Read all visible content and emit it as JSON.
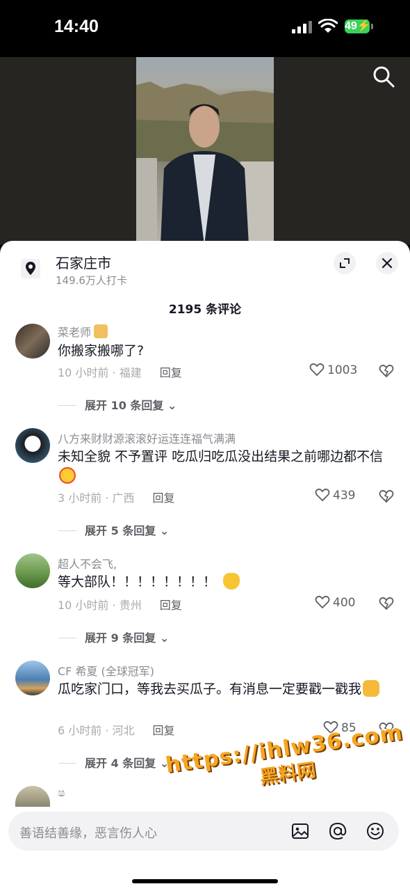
{
  "status": {
    "time": "14:40",
    "battery": "49"
  },
  "location": {
    "title": "石家庄市",
    "subtitle": "149.6万人打卡"
  },
  "comments_count": "2195 条评论",
  "comments": [
    {
      "user": "菜老师",
      "text": "你搬家搬哪了?",
      "meta": "10 小时前 · 福建",
      "reply": "回复",
      "likes": "1003",
      "expand": "展开 10 条回复"
    },
    {
      "user": "八方来财财源滚滚好运连连福气满满",
      "text": "未知全貌 不予置评 吃瓜归吃瓜没出结果之前哪边都不信",
      "meta": "3 小时前 · 广西",
      "reply": "回复",
      "likes": "439",
      "expand": "展开 5 条回复"
    },
    {
      "user": "超人不会飞,",
      "text": "等大部队！！！！！！！！",
      "meta": "10 小时前 · 贵州",
      "reply": "回复",
      "likes": "400",
      "expand": "展开 9 条回复"
    },
    {
      "user": "CF 希夏 (全球冠军)",
      "text": "瓜吃家门口，等我去买瓜子。有消息一定要戳一戳我",
      "meta": "6 小时前 · 河北",
      "reply": "回复",
      "likes": "85",
      "expand": "展开 4 条回复"
    }
  ],
  "input": {
    "placeholder": "善语结善缘，恶言伤人心"
  },
  "watermark": {
    "line1": "https://ihlw36.com",
    "line2": "黑料网"
  },
  "icons": [
    "search-icon",
    "location-pin-icon",
    "expand-icon",
    "close-icon",
    "heart-icon",
    "dislike-heart-icon",
    "image-icon",
    "at-icon",
    "emoji-icon"
  ]
}
